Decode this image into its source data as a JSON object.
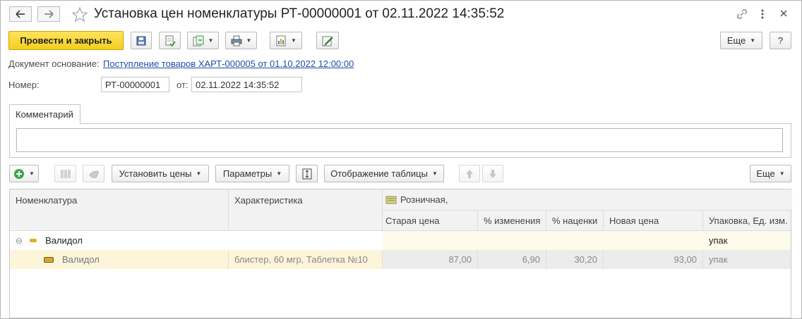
{
  "window": {
    "title": "Установка цен номенклатуры РТ-00000001 от 02.11.2022 14:35:52",
    "back_icon": "arrow-left-icon",
    "forward_icon": "arrow-right-icon",
    "favorite_icon": "star-icon",
    "link_icon": "link-icon",
    "menu_icon": "more-vertical-icon",
    "close_icon": "close-icon"
  },
  "toolbar": {
    "post_close_label": "Провести и закрыть",
    "more_label": "Еще",
    "help_label": "?"
  },
  "form": {
    "basis_label": "Документ основание:",
    "basis_link": "Поступление товаров ХАРТ-000005 от 01.10.2022 12:00:00",
    "number_label": "Номер:",
    "number_value": "РТ-00000001",
    "date_label": "от:",
    "date_value": "02.11.2022 14:35:52"
  },
  "comment": {
    "tab_label": "Комментарий",
    "value": ""
  },
  "table_toolbar": {
    "set_prices_label": "Установить цены",
    "params_label": "Параметры",
    "display_label": "Отображение таблицы",
    "more_label": "Еще"
  },
  "table": {
    "columns": {
      "nomenclature": "Номенклатура",
      "characteristic": "Характеристика",
      "group": "Розничная,",
      "old_price": "Старая цена",
      "change_pct": "% изменения",
      "markup_pct": "% наценки",
      "new_price": "Новая цена",
      "package": "Упаковка, Ед. изм."
    },
    "rows": [
      {
        "nomenclature": "Валидол",
        "characteristic": "",
        "old_price": "",
        "change_pct": "",
        "markup_pct": "",
        "new_price": "",
        "package": "упак"
      },
      {
        "nomenclature": "Валидол",
        "characteristic": "блистер, 60 мгр, Таблетка №10",
        "old_price": "87,00",
        "change_pct": "6,90",
        "markup_pct": "30,20",
        "new_price": "93,00",
        "package": "упак"
      }
    ]
  },
  "colors": {
    "accent_yellow": "#f5cf1f",
    "link_blue": "#1f4ea8",
    "row_highlight": "#fdf5d9",
    "group_row": "#fffbea",
    "add_green": "#3aa64a"
  }
}
